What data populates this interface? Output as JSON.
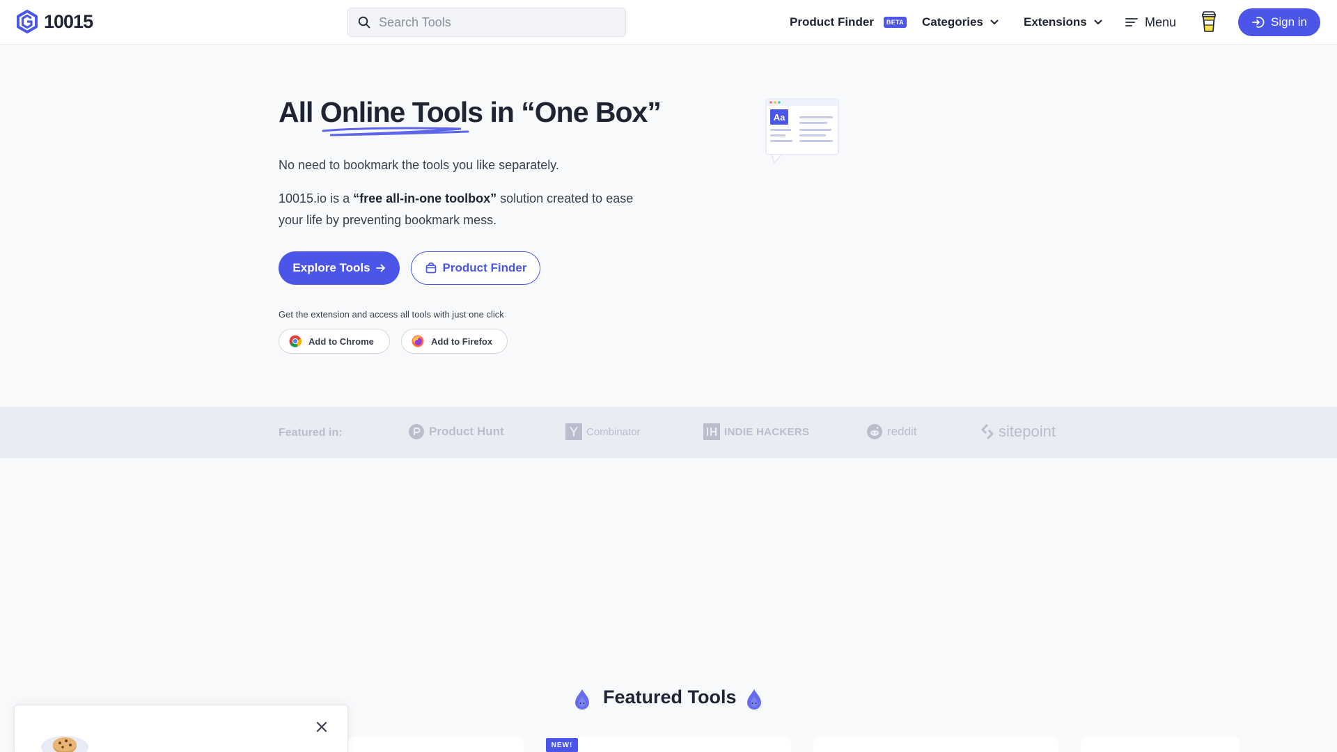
{
  "header": {
    "logo_text": "10015",
    "search_placeholder": "Search Tools",
    "nav": {
      "product_finder": "Product Finder",
      "beta_badge": "BETA",
      "categories": "Categories",
      "extensions": "Extensions",
      "menu": "Menu"
    },
    "sign_in": "Sign in"
  },
  "hero": {
    "title_start": "All ",
    "title_highlight": "Online Tools",
    "title_end": " in “One Box”",
    "paragraph1": "No need to bookmark the tools you like separately.",
    "paragraph2_pre": "10015.io is a ",
    "paragraph2_bold": "“free all-in-one toolbox”",
    "paragraph2_post": " solution created to ease your life by preventing bookmark mess.",
    "explore_button": "Explore Tools",
    "product_finder_button": "Product Finder",
    "extension_caption": "Get the extension and access all tools with just one click",
    "add_chrome": "Add to Chrome",
    "add_firefox": "Add to Firefox"
  },
  "featured_in": {
    "label": "Featured in:",
    "brands": {
      "product_hunt": "Product Hunt",
      "combinator": "Combinator",
      "indie_hackers": "INDIE HACKERS",
      "reddit": "reddit",
      "sitepoint": "sitepoint"
    }
  },
  "featured_tools": {
    "title": "Featured Tools",
    "new_badge": "NEW!"
  },
  "colors": {
    "accent": "#4b55e8",
    "text": "#1f2433",
    "muted_brand": "#b9bdcc"
  }
}
